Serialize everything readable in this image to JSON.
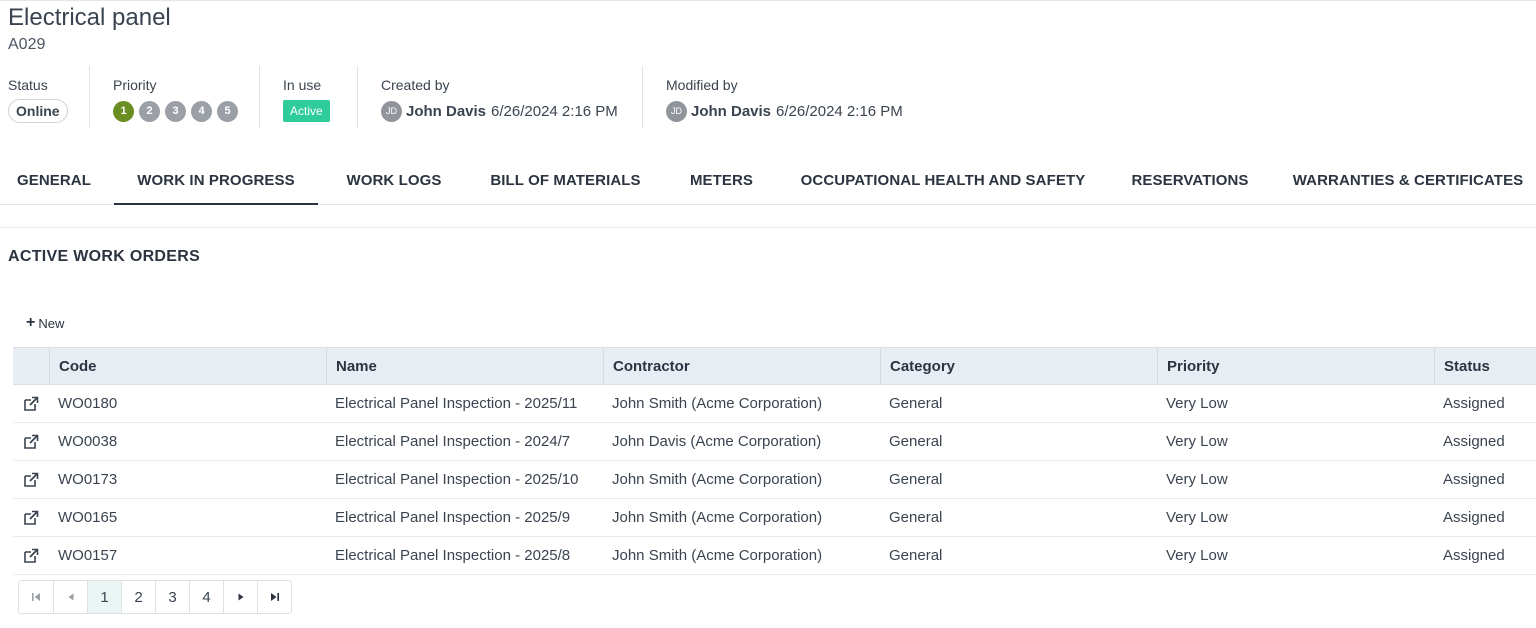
{
  "header": {
    "title": "Electrical panel",
    "code": "A029"
  },
  "meta": {
    "status_label": "Status",
    "status_value": "Online",
    "priority_label": "Priority",
    "priority_levels": [
      "1",
      "2",
      "3",
      "4",
      "5"
    ],
    "priority_selected": 1,
    "inuse_label": "In use",
    "inuse_value": "Active",
    "created_label": "Created by",
    "created_initials": "JD",
    "created_name": "John Davis",
    "created_date": "6/26/2024 2:16 PM",
    "modified_label": "Modified by",
    "modified_initials": "JD",
    "modified_name": "John Davis",
    "modified_date": "6/26/2024 2:16 PM"
  },
  "tabs": [
    {
      "label": "GENERAL"
    },
    {
      "label": "WORK IN PROGRESS"
    },
    {
      "label": "WORK LOGS"
    },
    {
      "label": "BILL OF MATERIALS"
    },
    {
      "label": "METERS"
    },
    {
      "label": "OCCUPATIONAL HEALTH AND SAFETY"
    },
    {
      "label": "RESERVATIONS"
    },
    {
      "label": "WARRANTIES & CERTIFICATES"
    }
  ],
  "active_tab": "WORK IN PROGRESS",
  "section": {
    "title": "ACTIVE WORK ORDERS",
    "new_label": "New"
  },
  "table": {
    "columns": [
      "Code",
      "Name",
      "Contractor",
      "Category",
      "Priority",
      "Status"
    ],
    "rows": [
      {
        "code": "WO0180",
        "name": "Electrical Panel Inspection - 2025/11",
        "contractor": "John Smith (Acme Corporation)",
        "category": "General",
        "priority": "Very Low",
        "status": "Assigned"
      },
      {
        "code": "WO0038",
        "name": "Electrical Panel Inspection - 2024/7",
        "contractor": "John Davis (Acme Corporation)",
        "category": "General",
        "priority": "Very Low",
        "status": "Assigned"
      },
      {
        "code": "WO0173",
        "name": "Electrical Panel Inspection - 2025/10",
        "contractor": "John Smith (Acme Corporation)",
        "category": "General",
        "priority": "Very Low",
        "status": "Assigned"
      },
      {
        "code": "WO0165",
        "name": "Electrical Panel Inspection - 2025/9",
        "contractor": "John Smith (Acme Corporation)",
        "category": "General",
        "priority": "Very Low",
        "status": "Assigned"
      },
      {
        "code": "WO0157",
        "name": "Electrical Panel Inspection - 2025/8",
        "contractor": "John Smith (Acme Corporation)",
        "category": "General",
        "priority": "Very Low",
        "status": "Assigned"
      }
    ]
  },
  "pager": {
    "pages": [
      "1",
      "2",
      "3",
      "4"
    ],
    "current": "1"
  },
  "colors": {
    "priority_active": "#6b8e23",
    "priority_inactive": "#9aa0a6",
    "active_badge": "#2ecc9a",
    "table_header_bg": "#e8edf4",
    "current_page_bg": "#eaf6f3"
  },
  "icons": {
    "row_action": "external-link-icon",
    "add": "plus-icon",
    "first": "first-page-icon",
    "prev": "prev-page-icon",
    "next": "next-page-icon",
    "last": "last-page-icon"
  }
}
